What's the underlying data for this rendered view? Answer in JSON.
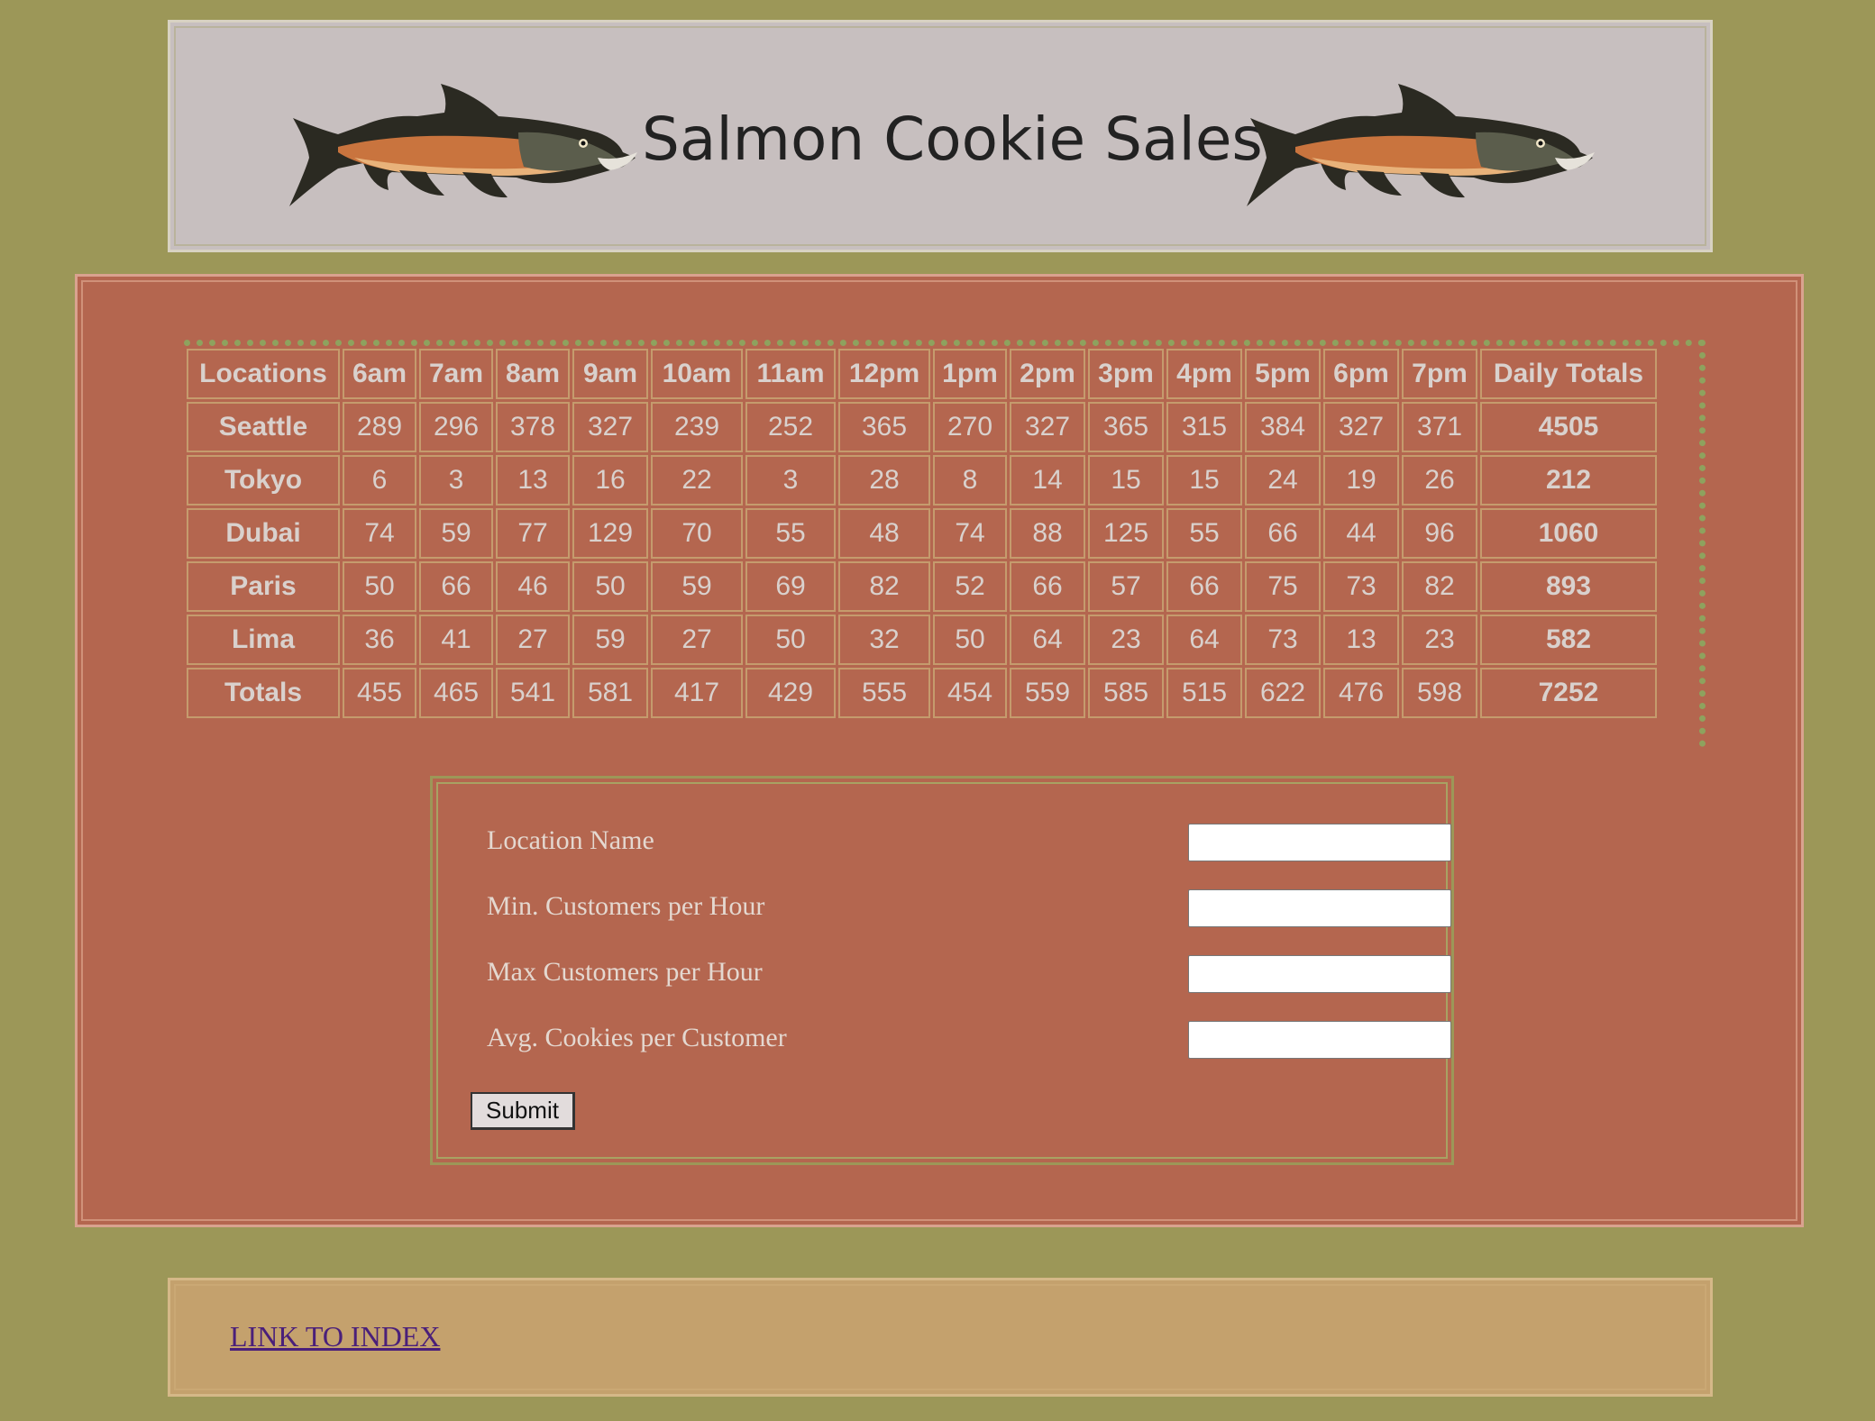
{
  "header": {
    "title": "Salmon Cookie Sales",
    "fish_icon": "salmon-fish-image"
  },
  "table": {
    "headers": [
      "Locations",
      "6am",
      "7am",
      "8am",
      "9am",
      "10am",
      "11am",
      "12pm",
      "1pm",
      "2pm",
      "3pm",
      "4pm",
      "5pm",
      "6pm",
      "7pm",
      "Daily Totals"
    ],
    "rows": [
      {
        "location": "Seattle",
        "values": [
          "289",
          "296",
          "378",
          "327",
          "239",
          "252",
          "365",
          "270",
          "327",
          "365",
          "315",
          "384",
          "327",
          "371"
        ],
        "total": "4505"
      },
      {
        "location": "Tokyo",
        "values": [
          "6",
          "3",
          "13",
          "16",
          "22",
          "3",
          "28",
          "8",
          "14",
          "15",
          "15",
          "24",
          "19",
          "26"
        ],
        "total": "212"
      },
      {
        "location": "Dubai",
        "values": [
          "74",
          "59",
          "77",
          "129",
          "70",
          "55",
          "48",
          "74",
          "88",
          "125",
          "55",
          "66",
          "44",
          "96"
        ],
        "total": "1060"
      },
      {
        "location": "Paris",
        "values": [
          "50",
          "66",
          "46",
          "50",
          "59",
          "69",
          "82",
          "52",
          "66",
          "57",
          "66",
          "75",
          "73",
          "82"
        ],
        "total": "893"
      },
      {
        "location": "Lima",
        "values": [
          "36",
          "41",
          "27",
          "59",
          "27",
          "50",
          "32",
          "50",
          "64",
          "23",
          "64",
          "73",
          "13",
          "23"
        ],
        "total": "582"
      }
    ],
    "footer": {
      "location": "Totals",
      "values": [
        "455",
        "465",
        "541",
        "581",
        "417",
        "429",
        "555",
        "454",
        "559",
        "585",
        "515",
        "622",
        "476",
        "598"
      ],
      "total": "7252"
    }
  },
  "form": {
    "fields": [
      {
        "label": "Location Name",
        "value": ""
      },
      {
        "label": "Min. Customers per Hour",
        "value": ""
      },
      {
        "label": "Max Customers per Hour",
        "value": ""
      },
      {
        "label": "Avg. Cookies per Customer",
        "value": ""
      }
    ],
    "submit_label": "Submit"
  },
  "footer": {
    "link_text": "LINK TO INDEX"
  },
  "colors": {
    "page_bg": "#9c9758",
    "header_bg": "#c7bfbf",
    "main_bg": "#b4664f",
    "footer_bg": "#c4a16d",
    "table_text": "#d9d1cd",
    "link": "#4a1f7a"
  }
}
